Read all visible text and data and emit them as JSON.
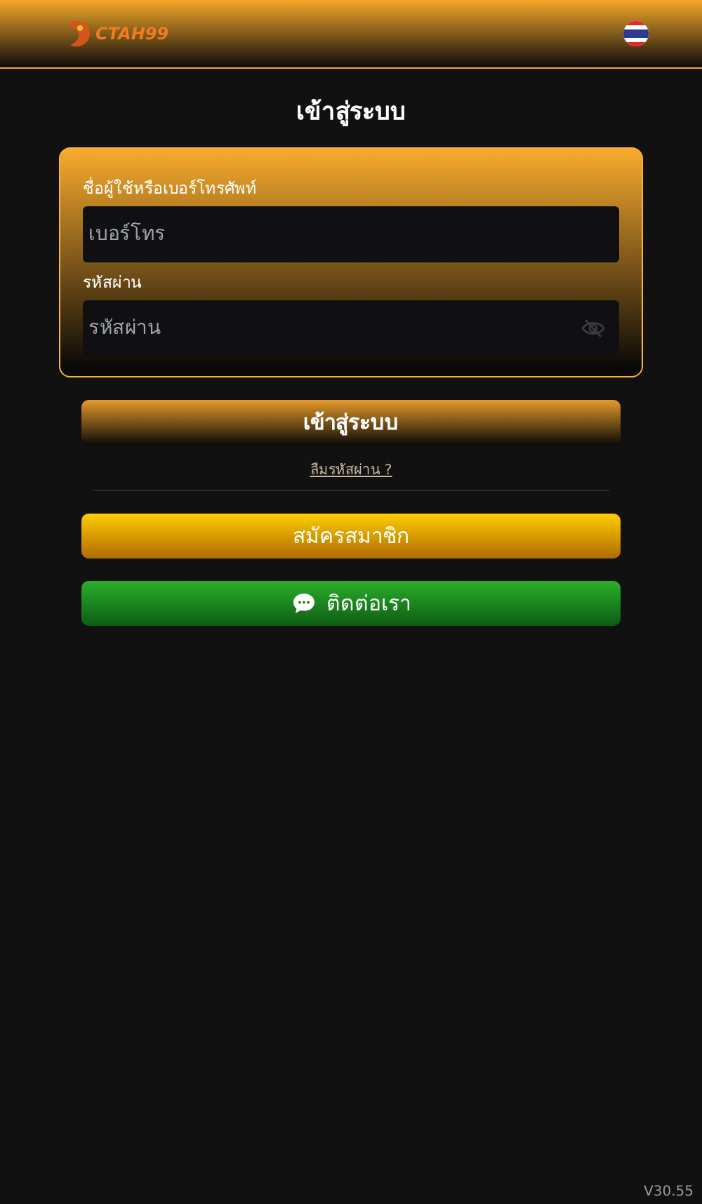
{
  "header": {
    "logo_text": "CTAH99"
  },
  "title": "เข้าสู่ระบบ",
  "form": {
    "fields": [
      {
        "label": "ชื่อผู้ใช้หรือเบอร์โทรศัพท์",
        "placeholder": "เบอร์โทร",
        "kind": "text"
      },
      {
        "label": "รหัสผ่าน",
        "placeholder": "รหัสผ่าน",
        "kind": "password"
      }
    ]
  },
  "login_button": "เข้าสู่ระบบ",
  "forgot_link": "ลืมรหัสผ่าน ?",
  "register_button": "สมัครสมาชิก",
  "contact_button": "ติดต่อเรา",
  "version": "V30.55"
}
